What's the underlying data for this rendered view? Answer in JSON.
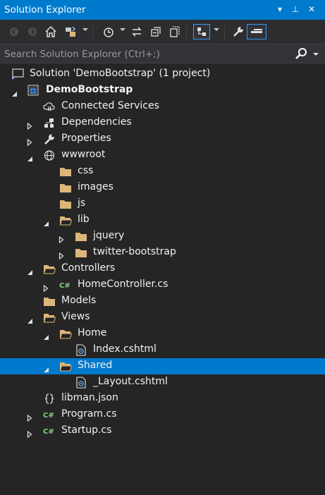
{
  "window": {
    "title": "Solution Explorer"
  },
  "title_buttons": {
    "dropdown_icon": "▾",
    "pin_icon": "⊥",
    "close_icon": "✕"
  },
  "toolbar": {
    "tools": [
      "back-icon",
      "forward-icon",
      "home-icon",
      "switch-views-icon",
      "pending-changes-filter-icon",
      "sync-icon",
      "collapse-all-icon",
      "show-all-files-icon",
      "preview-selected-icon",
      "properties-icon",
      "auto-hide-icon"
    ]
  },
  "search": {
    "placeholder": "Search Solution Explorer (Ctrl+;)"
  },
  "tree": [
    {
      "label": "Solution 'DemoBootstrap' (1 project)",
      "icon": "solution-icon",
      "expander": "none",
      "bold": false
    },
    {
      "label": "DemoBootstrap",
      "icon": "web-project-icon",
      "expander": "expanded",
      "bold": true
    },
    {
      "label": "Connected Services",
      "icon": "connected-services-icon",
      "expander": "none"
    },
    {
      "label": "Dependencies",
      "icon": "dependencies-icon",
      "expander": "collapsed"
    },
    {
      "label": "Properties",
      "icon": "wrench-icon",
      "expander": "collapsed"
    },
    {
      "label": "wwwroot",
      "icon": "globe-icon",
      "expander": "expanded"
    },
    {
      "label": "css",
      "icon": "folder-icon",
      "expander": "none"
    },
    {
      "label": "images",
      "icon": "folder-icon",
      "expander": "none"
    },
    {
      "label": "js",
      "icon": "folder-icon",
      "expander": "none"
    },
    {
      "label": "lib",
      "icon": "folder-open-icon",
      "expander": "expanded"
    },
    {
      "label": "jquery",
      "icon": "folder-icon",
      "expander": "collapsed"
    },
    {
      "label": "twitter-bootstrap",
      "icon": "folder-icon",
      "expander": "collapsed"
    },
    {
      "label": "Controllers",
      "icon": "folder-open-icon",
      "expander": "expanded"
    },
    {
      "label": "HomeController.cs",
      "icon": "csharp-file-icon",
      "expander": "collapsed"
    },
    {
      "label": "Models",
      "icon": "folder-icon",
      "expander": "none"
    },
    {
      "label": "Views",
      "icon": "folder-open-icon",
      "expander": "expanded"
    },
    {
      "label": "Home",
      "icon": "folder-open-icon",
      "expander": "expanded"
    },
    {
      "label": "Index.cshtml",
      "icon": "razor-file-icon",
      "expander": "none"
    },
    {
      "label": "Shared",
      "icon": "folder-open-icon",
      "expander": "expanded",
      "selected": true
    },
    {
      "label": "_Layout.cshtml",
      "icon": "razor-file-icon",
      "expander": "none"
    },
    {
      "label": "libman.json",
      "icon": "json-file-icon",
      "expander": "none"
    },
    {
      "label": "Program.cs",
      "icon": "csharp-file-icon",
      "expander": "collapsed"
    },
    {
      "label": "Startup.cs",
      "icon": "csharp-file-icon",
      "expander": "collapsed"
    }
  ]
}
